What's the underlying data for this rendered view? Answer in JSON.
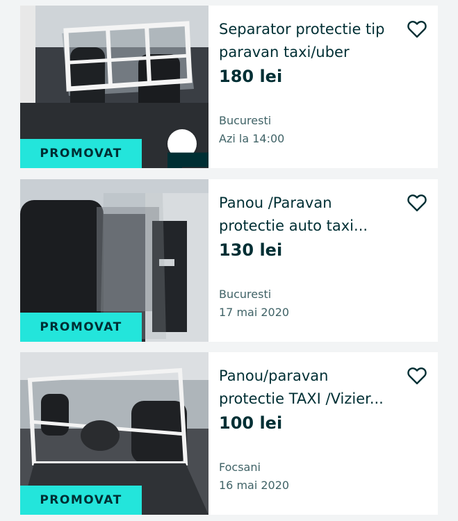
{
  "colors": {
    "promo_bg": "#23e5db",
    "text_dark": "#002f34",
    "text_muted": "#406367",
    "page_bg": "#f2f4f5"
  },
  "listings": [
    {
      "title": "Separator protectie tip paravan taxi/uber",
      "price": "180 lei",
      "location": "Bucuresti",
      "date": "Azi la 14:00",
      "badge": "PROMOVAT",
      "delivery_icon": "truck-icon",
      "favorite_icon": "heart-outline-icon"
    },
    {
      "title": "Panou /Paravan protectie auto taxi...",
      "price": "130 lei",
      "location": "Bucuresti",
      "date": "17 mai 2020",
      "badge": "PROMOVAT",
      "favorite_icon": "heart-outline-icon"
    },
    {
      "title": "Panou/paravan protectie TAXI /Vizier...",
      "price": "100 lei",
      "location": "Focsani",
      "date": "16 mai 2020",
      "badge": "PROMOVAT",
      "favorite_icon": "heart-outline-icon"
    }
  ]
}
